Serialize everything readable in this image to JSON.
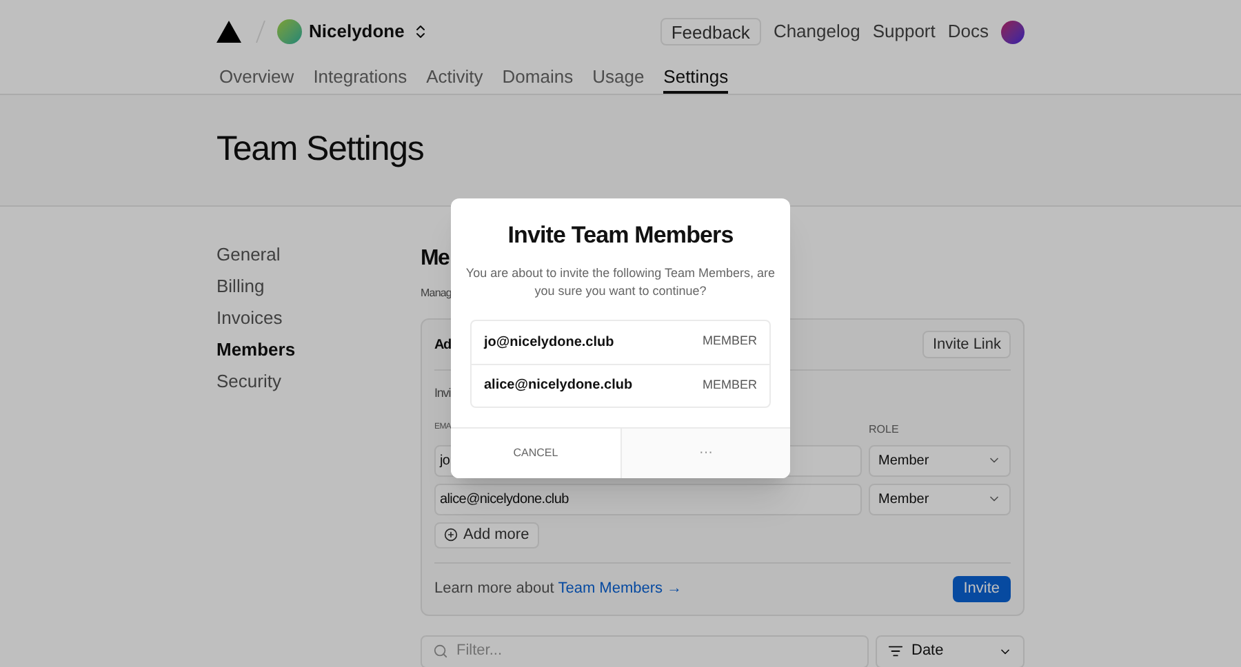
{
  "header": {
    "team": "Nicelydone",
    "feedback": "Feedback",
    "links": [
      "Changelog",
      "Support",
      "Docs"
    ]
  },
  "tabs": [
    {
      "label": "Overview",
      "selected": false
    },
    {
      "label": "Integrations",
      "selected": false
    },
    {
      "label": "Activity",
      "selected": false
    },
    {
      "label": "Domains",
      "selected": false
    },
    {
      "label": "Usage",
      "selected": false
    },
    {
      "label": "Settings",
      "selected": true
    }
  ],
  "page_title": "Team Settings",
  "sidebar": {
    "items": [
      {
        "label": "General",
        "selected": false
      },
      {
        "label": "Billing",
        "selected": false
      },
      {
        "label": "Invoices",
        "selected": false
      },
      {
        "label": "Members",
        "selected": true
      },
      {
        "label": "Security",
        "selected": false
      }
    ]
  },
  "section": {
    "heading": "Me",
    "description": "Manag"
  },
  "card": {
    "title": "Ad",
    "invite_link": "Invite Link",
    "subtitle": "Invi",
    "email_label": "EMA",
    "role_label": "ROLE",
    "rows": [
      {
        "email": "jo",
        "role": "Member"
      },
      {
        "email": "alice@nicelydone.club",
        "role": "Member"
      }
    ],
    "add_more": "Add more",
    "learn_prefix": "Learn more about",
    "learn_link": "Team Members →",
    "invite": "Invite"
  },
  "filter": {
    "placeholder": "Filter...",
    "sort": "Date"
  },
  "modal": {
    "title": "Invite Team Members",
    "text": "You are about to invite the following Team Members, are you sure you want to continue?",
    "members": [
      {
        "email": "jo@nicelydone.club",
        "role": "MEMBER"
      },
      {
        "email": "alice@nicelydone.club",
        "role": "MEMBER"
      }
    ],
    "cancel": "CANCEL",
    "confirm": "···"
  }
}
